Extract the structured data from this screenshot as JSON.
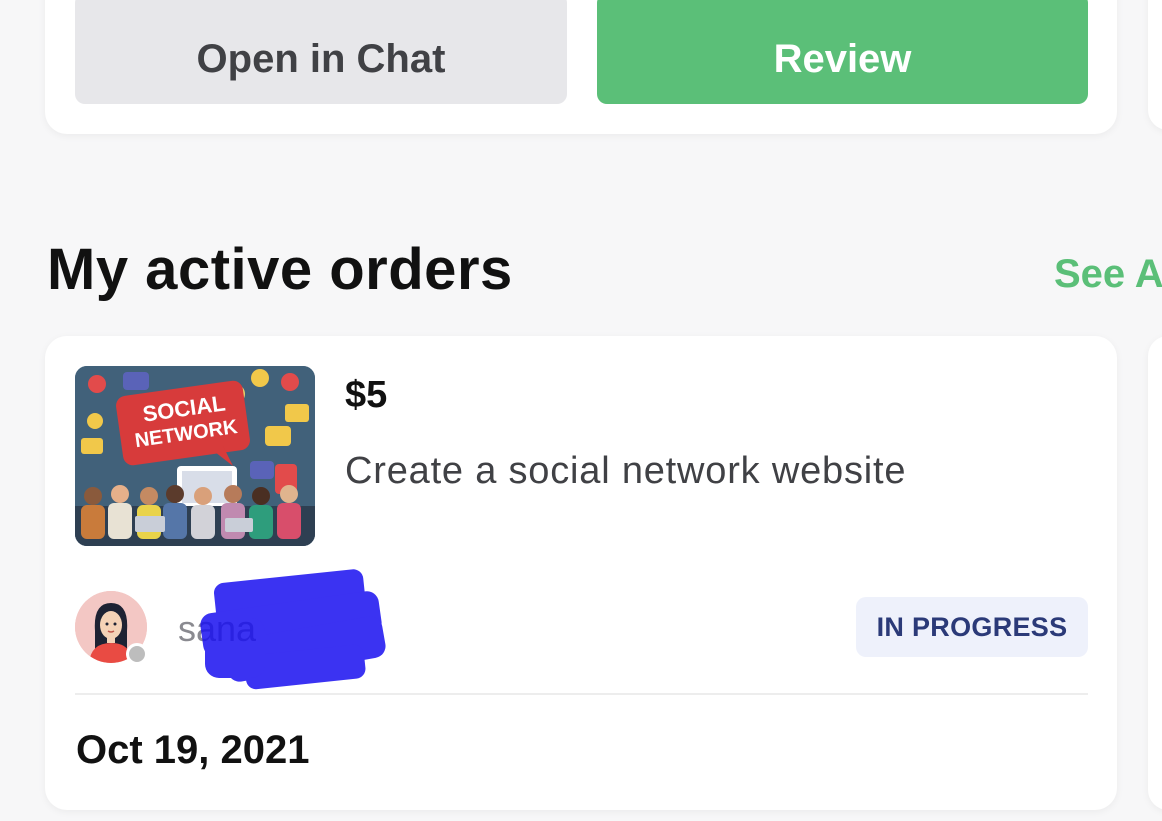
{
  "top_card": {
    "open_chat_label": "Open in Chat",
    "review_label": "Review"
  },
  "section": {
    "title": "My active orders",
    "see_all_label": "See A"
  },
  "order": {
    "price": "$5",
    "title": "Create a social network website",
    "thumbnail_text_line1": "SOCIAL",
    "thumbnail_text_line2": "NETWORK",
    "seller_username": "sana",
    "status": "IN PROGRESS",
    "date": "Oct 19, 2021"
  },
  "colors": {
    "accent": "#5bbf78",
    "status_text": "#2b3a78",
    "status_bg": "#eef1fb"
  }
}
